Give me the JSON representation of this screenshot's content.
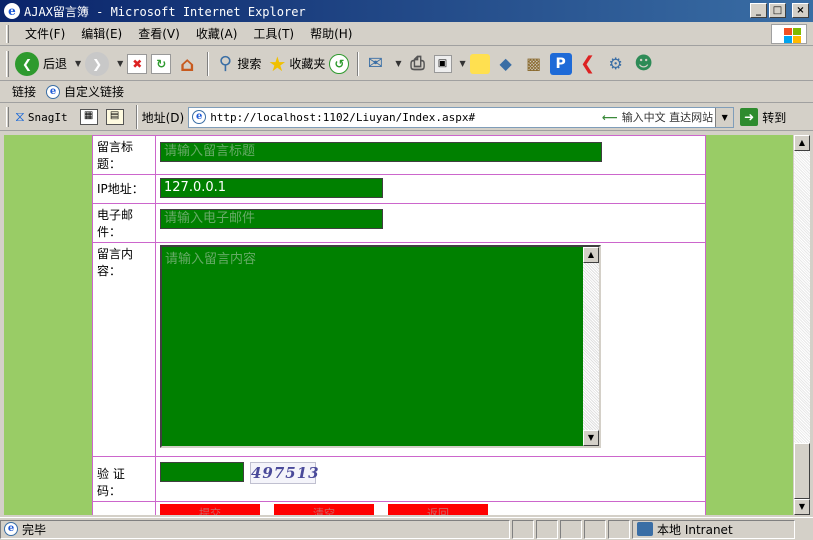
{
  "window": {
    "title": "AJAX留言簿 - Microsoft Internet Explorer",
    "app_icon": "ie-icon",
    "controls": {
      "minimize": "_",
      "maximize": "□",
      "close": "×"
    }
  },
  "menu": {
    "items": [
      {
        "label": "文件(F)"
      },
      {
        "label": "编辑(E)"
      },
      {
        "label": "查看(V)"
      },
      {
        "label": "收藏(A)"
      },
      {
        "label": "工具(T)"
      },
      {
        "label": "帮助(H)"
      }
    ]
  },
  "toolbar": {
    "back_label": "后退",
    "search_label": "搜索",
    "favorites_label": "收藏夹"
  },
  "links_bar": {
    "label": "链接",
    "custom_link": "自定义链接"
  },
  "address_bar": {
    "snagit_label": "SnagIt",
    "label": "地址(D)",
    "url": "http://localhost:1102/Liuyan/Index.aspx#",
    "hint": "输入中文 直达网站",
    "go_label": "转到"
  },
  "form": {
    "title_label": "留言标题：",
    "title_placeholder": "请输入留言标题",
    "ip_label": "IP地址：",
    "ip_value": "127.0.0.1",
    "email_label": "电子邮件：",
    "email_placeholder": "请输入电子邮件",
    "content_label": "留言内容：",
    "content_placeholder": "请输入留言内容",
    "captcha_label": "验 证 码：",
    "captcha_value": "497513",
    "buttons": [
      "提交",
      "清空",
      "返回"
    ]
  },
  "status_bar": {
    "text": "完毕",
    "zone": "本地 Intranet"
  },
  "colors": {
    "page_bg": "#99cc66",
    "field_bg": "#008000",
    "button_bg": "#ff0000",
    "table_border": "#cc66cc"
  }
}
